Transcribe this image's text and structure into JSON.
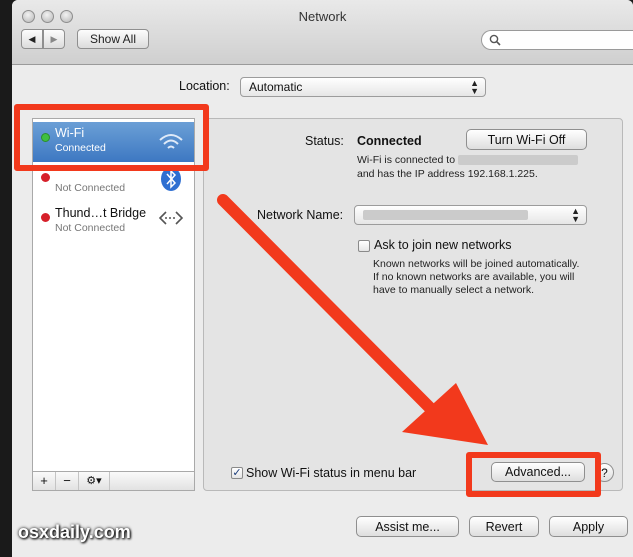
{
  "window": {
    "title": "Network"
  },
  "toolbar": {
    "show_all_label": "Show All",
    "back_glyph": "◀",
    "forward_glyph": "▶"
  },
  "location": {
    "label": "Location:",
    "value": "Automatic"
  },
  "services": [
    {
      "name": "Wi-Fi",
      "status": "Connected",
      "dot_color": "#3fbf3f",
      "icon": "wifi-icon"
    },
    {
      "name": "",
      "status": "Not Connected",
      "dot_color": "#d6202a",
      "icon": "bluetooth-icon"
    },
    {
      "name": "Thund…t Bridge",
      "status": "Not Connected",
      "dot_color": "#d6202a",
      "icon": "thunderbolt-bridge-icon"
    }
  ],
  "sidebar_tools": {
    "add": "+",
    "remove": "−",
    "gear": "⚙▾"
  },
  "status": {
    "label": "Status:",
    "value": "Connected",
    "toggle_button": "Turn Wi-Fi Off",
    "desc_line1": "Wi-Fi is connected to",
    "desc_line2": "and has the IP address 192.168.1.225."
  },
  "network_name": {
    "label": "Network Name:"
  },
  "ask_to_join": {
    "label": "Ask to join new networks",
    "checked": false,
    "help_line1": "Known networks will be joined automatically.",
    "help_line2": "If no known networks are available, you will",
    "help_line3": "have to manually select a network."
  },
  "show_wifi_status": {
    "label": "Show Wi-Fi status in menu bar",
    "checked": true,
    "check_glyph": "✓"
  },
  "buttons": {
    "advanced": "Advanced...",
    "help": "?",
    "assist": "Assist me...",
    "revert": "Revert",
    "apply": "Apply"
  },
  "watermark": "osxdaily.com",
  "colors": {
    "annotation_red": "#f2391c",
    "selection_blue": "#3d78c2"
  }
}
